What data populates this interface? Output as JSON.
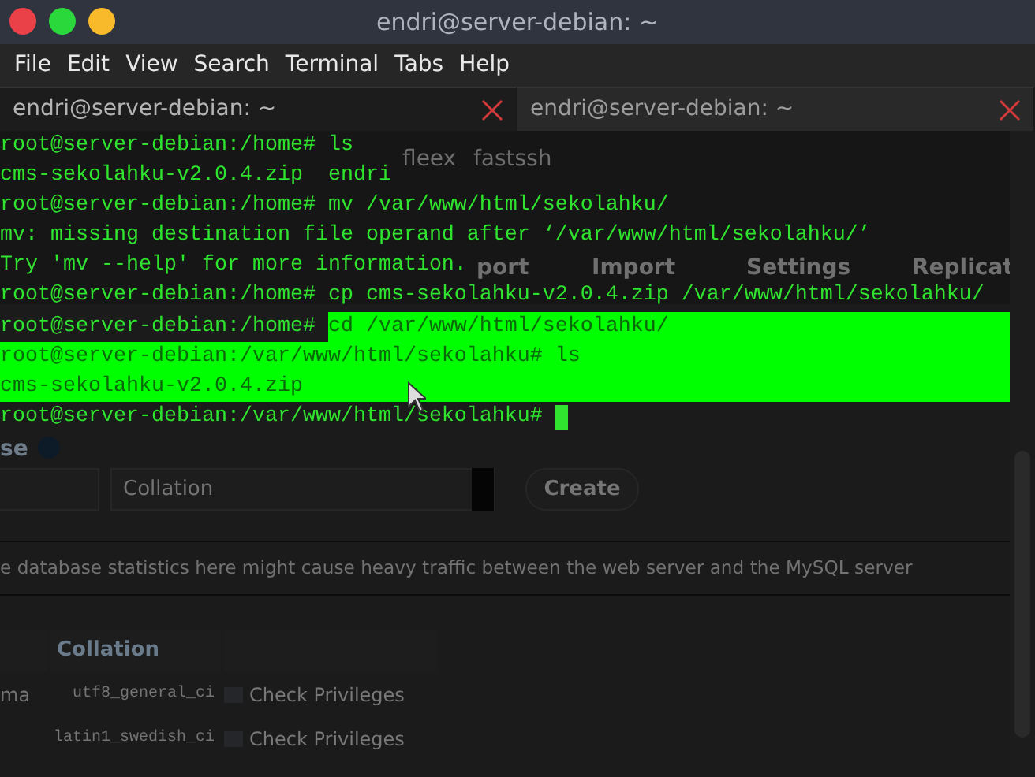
{
  "window": {
    "title": "endri@server-debian: ~",
    "controls": [
      {
        "kind": "close",
        "color": "#ea4149"
      },
      {
        "kind": "maximize",
        "color": "#2bd83c"
      },
      {
        "kind": "minimize",
        "color": "#f8b92b"
      }
    ]
  },
  "menu": [
    "File",
    "Edit",
    "View",
    "Search",
    "Terminal",
    "Tabs",
    "Help"
  ],
  "tabs": [
    {
      "label": "endri@server-debian: ~",
      "selected": true
    },
    {
      "label": "endri@server-debian: ~",
      "selected": false
    }
  ],
  "terminal": {
    "lines": [
      {
        "segments": [
          {
            "text": "root@server-debian:/home# ls",
            "selected": false
          }
        ]
      },
      {
        "segments": [
          {
            "text": "cms-sekolahku-v2.0.4.zip  endri",
            "selected": false
          }
        ]
      },
      {
        "segments": [
          {
            "text": "root@server-debian:/home# mv /var/www/html/sekolahku/",
            "selected": false
          }
        ]
      },
      {
        "segments": [
          {
            "text": "mv: missing destination file operand after ‘/var/www/html/sekolahku/’",
            "selected": false
          }
        ]
      },
      {
        "segments": [
          {
            "text": "Try 'mv --help' for more information.",
            "selected": false
          }
        ]
      },
      {
        "segments": [
          {
            "text": "root@server-debian:/home# cp cms-sekolahku-v2.0.4.zip /var/www/html/sekolahku/",
            "selected": false
          }
        ]
      },
      {
        "segments": [
          {
            "text": "root@server-debian:/home# ",
            "selected": false
          },
          {
            "text": "cd /var/www/html/sekolahku/",
            "selected": true
          }
        ]
      },
      {
        "segments": [
          {
            "text": "root@server-debian:/var/www/html/sekolahku# ls",
            "selected": true
          }
        ]
      },
      {
        "segments": [
          {
            "text": "cms-sekolahku-v2.0.4.zip",
            "selected": true
          }
        ]
      },
      {
        "segments": [
          {
            "text": "root@server-debian:/var/www/html/sekolahku# ",
            "selected": false
          }
        ],
        "cursor": true
      }
    ]
  },
  "background_page": {
    "bookmarks": [
      "fleex",
      "fastssh"
    ],
    "toolbar": [
      "port",
      "Import",
      "Settings",
      "Replicat"
    ],
    "section_title": "se",
    "collation_select": "Collation",
    "create_button": "Create",
    "notice": "e database statistics here might cause heavy traffic between the web server and the MySQL server",
    "table": {
      "columns": [
        "Collation"
      ],
      "rows": [
        {
          "name": "ma",
          "collation": "utf8_general_ci",
          "action": "Check Privileges"
        },
        {
          "collation": "latin1_swedish_ci",
          "action": "Check Privileges"
        }
      ]
    }
  }
}
